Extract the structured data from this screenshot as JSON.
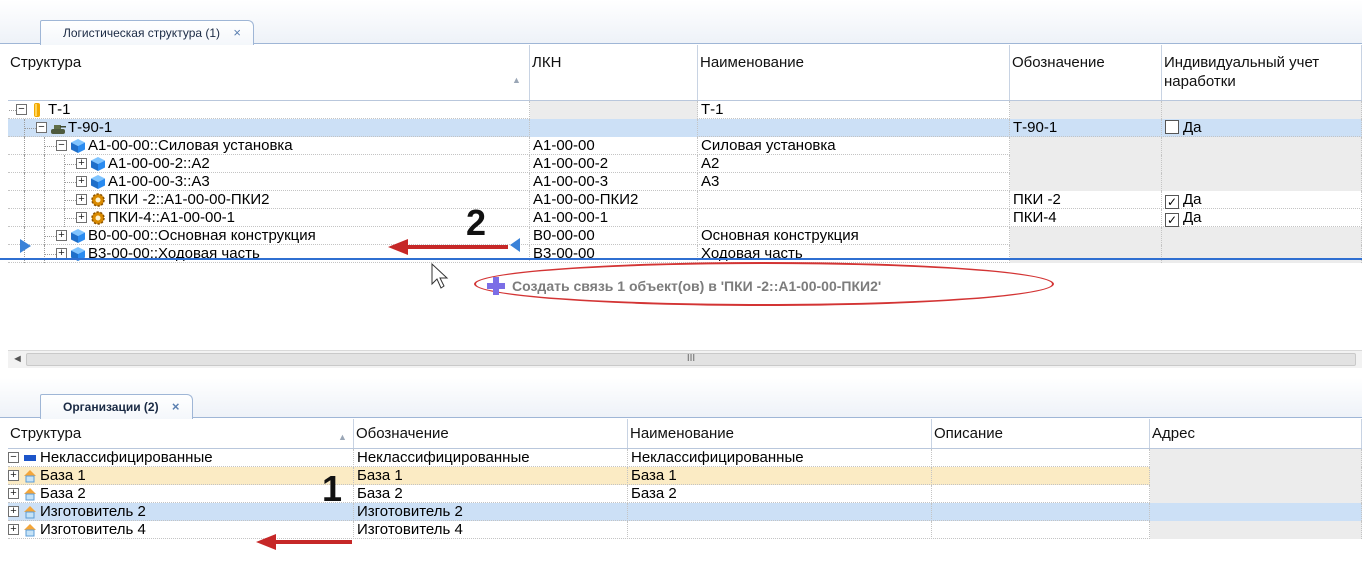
{
  "top_panel": {
    "tab_label": "Логистическая структура (1)",
    "close_glyph": "×",
    "columns": {
      "structure": "Структура",
      "lkn": "ЛКН",
      "name": "Наименование",
      "designation": "Обозначение",
      "individual": "Индивидуальный учет наработки"
    },
    "rows": [
      {
        "label": "Т-1",
        "lkn": "",
        "name": "Т-1",
        "designation": "",
        "individual": "",
        "icon": "folder-icon"
      },
      {
        "label": "Т-90-1",
        "lkn": "",
        "name": "",
        "designation": "Т-90-1",
        "individual": "Да",
        "checked": false,
        "icon": "tank-icon"
      },
      {
        "label": "А1-00-00::Силовая установка",
        "lkn": "А1-00-00",
        "name": "Силовая установка",
        "designation": "",
        "individual": "",
        "icon": "cube-icon"
      },
      {
        "label": "А1-00-00-2::А2",
        "lkn": "А1-00-00-2",
        "name": "А2",
        "designation": "",
        "individual": "",
        "icon": "cube-icon"
      },
      {
        "label": "А1-00-00-3::А3",
        "lkn": "А1-00-00-3",
        "name": "А3",
        "designation": "",
        "individual": "",
        "icon": "cube-icon"
      },
      {
        "label": "ПКИ -2::А1-00-00-ПКИ2",
        "lkn": "А1-00-00-ПКИ2",
        "name": "",
        "designation": "ПКИ -2",
        "individual": "Да",
        "checked": true,
        "icon": "gear-icon"
      },
      {
        "label": "ПКИ-4::А1-00-00-1",
        "lkn": "А1-00-00-1",
        "name": "",
        "designation": "ПКИ-4",
        "individual": "Да",
        "checked": true,
        "icon": "gear-icon"
      },
      {
        "label": "В0-00-00::Основная конструкция",
        "lkn": "В0-00-00",
        "name": "Основная конструкция",
        "designation": "",
        "individual": "",
        "icon": "cube-icon"
      },
      {
        "label": "В3-00-00::Ходовая часть",
        "lkn": "В3-00-00",
        "name": "Ходовая часть",
        "designation": "",
        "individual": "",
        "icon": "cube-icon"
      }
    ],
    "drag_hint": "Создать связь 1 объект(ов) в 'ПКИ -2::А1-00-00-ПКИ2'",
    "scrollbar_grip": "III",
    "callout": "2"
  },
  "bottom_panel": {
    "tab_label": "Организации (2)",
    "close_glyph": "×",
    "columns": {
      "structure": "Структура",
      "designation": "Обозначение",
      "name": "Наименование",
      "description": "Описание",
      "address": "Адрес"
    },
    "rows": [
      {
        "label": "Неклассифицированные",
        "designation": "Неклассифицированные",
        "name": "Неклассифицированные",
        "description": "",
        "address": "",
        "icon": "category-icon"
      },
      {
        "label": "База 1",
        "designation": "База 1",
        "name": "База 1",
        "description": "",
        "address": "",
        "icon": "organization-icon"
      },
      {
        "label": "База 2",
        "designation": "База 2",
        "name": "База 2",
        "description": "",
        "address": "",
        "icon": "organization-icon"
      },
      {
        "label": "Изготовитель 2",
        "designation": "Изготовитель 2",
        "name": "",
        "description": "",
        "address": "",
        "icon": "organization-icon"
      },
      {
        "label": "Изготовитель 4",
        "designation": "Изготовитель 4",
        "name": "",
        "description": "",
        "address": "",
        "icon": "organization-icon"
      }
    ],
    "callout": "1"
  },
  "colors": {
    "selection": "#cce0f6",
    "highlight": "#fbebc4",
    "accent": "#3a82d8",
    "annotation_red": "#c62828"
  }
}
